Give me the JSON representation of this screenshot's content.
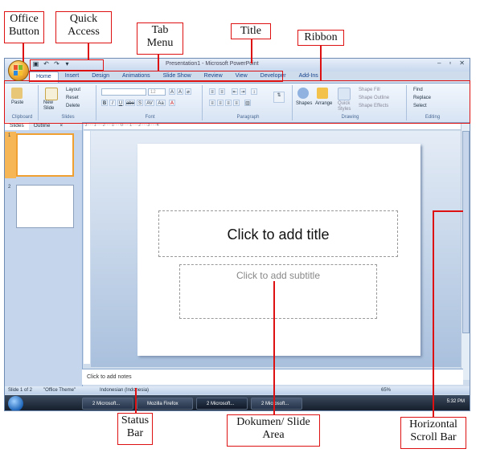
{
  "annotations": {
    "office_button": "Office\nButton",
    "quick_access": "Quick\nAccess",
    "tab_menu": "Tab\nMenu",
    "title": "Title",
    "ribbon": "Ribbon",
    "status_bar": "Status\nBar",
    "slide_area": "Dokumen/ Slide\nArea",
    "scroll_bar": "Horizontal\nScroll Bar"
  },
  "window": {
    "title": "Presentation1 - Microsoft PowerPoint",
    "controls": [
      "–",
      "▫",
      "✕"
    ]
  },
  "tabs": [
    "Home",
    "Insert",
    "Design",
    "Animations",
    "Slide Show",
    "Review",
    "View",
    "Developer",
    "Add-Ins"
  ],
  "ribbon": {
    "clipboard": {
      "paste": "Paste",
      "label": "Clipboard"
    },
    "slides": {
      "new_slide": "New\nSlide",
      "layout": "Layout",
      "reset": "Reset",
      "delete": "Delete",
      "label": "Slides"
    },
    "font": {
      "size": "12",
      "bold": "B",
      "italic": "I",
      "underline": "U",
      "strike": "abe",
      "shadow": "S",
      "spacing": "AV",
      "case": "Aa",
      "label": "Font"
    },
    "paragraph": {
      "label": "Paragraph"
    },
    "drawing": {
      "shapes": "Shapes",
      "arrange": "Arrange",
      "quick_styles": "Quick\nStyles",
      "shape_fill": "Shape Fill",
      "shape_outline": "Shape Outline",
      "shape_effects": "Shape Effects",
      "label": "Drawing"
    },
    "editing": {
      "find": "Find",
      "replace": "Replace",
      "select": "Select",
      "label": "Editing"
    }
  },
  "panel": {
    "tab_slides": "Slides",
    "tab_outline": "Outline",
    "close": "×",
    "thumbs": [
      "1",
      "2"
    ]
  },
  "ruler_text": "·3·····1·····2·····1·····0·····1·····2·····3·····4·",
  "slide": {
    "title_placeholder": "Click to add title",
    "subtitle_placeholder": "Click to add subtitle"
  },
  "notes": "Click to add notes",
  "status": {
    "slide": "Slide 1 of 2",
    "theme": "\"Office Theme\"",
    "language": "Indonesian (Indonesia)",
    "zoom": "65%"
  },
  "taskbar": {
    "items": [
      "2 Microsoft...",
      "Mozilla Firefox",
      "2 Microsoft...",
      "2 Microsoft..."
    ],
    "clock": "5:32 PM"
  }
}
